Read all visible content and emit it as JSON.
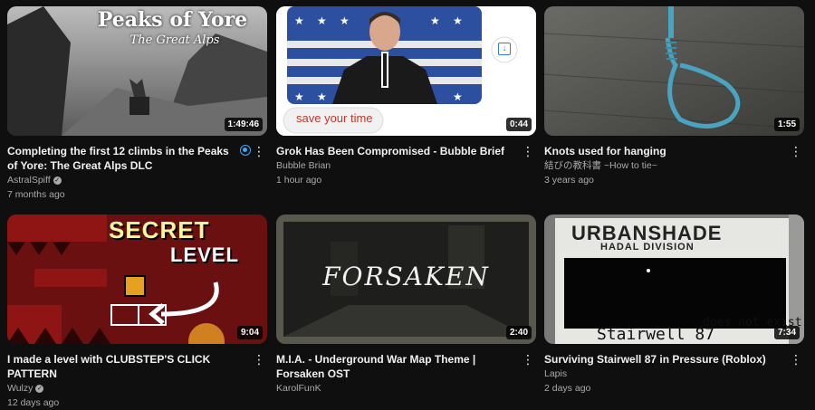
{
  "videos": [
    {
      "title": "Completing the first 12 climbs in the Peaks of Yore: The Great Alps DLC",
      "channel": "AstralSpiff",
      "verified": true,
      "age": "7 months ago",
      "duration": "1:49:46",
      "thumb_text": [
        "Peaks of Yore",
        "The Great Alps"
      ]
    },
    {
      "title": "Grok Has Been Compromised - Bubble Brief",
      "channel": "Bubble Brian",
      "verified": false,
      "age": "1 hour ago",
      "duration": "0:44",
      "thumb_text": [
        "save your time"
      ]
    },
    {
      "title": "Knots used for hanging",
      "channel": "結びの教科書 ~How to tie~",
      "verified": false,
      "age": "3 years ago",
      "duration": "1:55",
      "thumb_text": []
    },
    {
      "title": "I made a level with CLUBSTEP'S CLICK PATTERN",
      "channel": "Wulzy",
      "verified": true,
      "age": "12 days ago",
      "duration": "9:04",
      "thumb_text": [
        "SECRET",
        "LEVEL"
      ]
    },
    {
      "title": "M.I.A. - Underground War Map Theme | Forsaken OST",
      "channel": "KarolFunK",
      "verified": false,
      "age": "",
      "duration": "2:40",
      "thumb_text": [
        "FORSAKEN"
      ]
    },
    {
      "title": "Surviving Stairwell 87 in Pressure (Roblox)",
      "channel": "Lapis",
      "verified": false,
      "age": "2 days ago",
      "duration": "7:34",
      "thumb_text": [
        "URBANSHADE",
        "HADAL DIVISION",
        "Stairwell 87",
        "does not exist"
      ]
    }
  ],
  "icons": {
    "more": "more-vert-icon",
    "watched": "watched-indicator-icon",
    "verified": "verified-check-icon",
    "save": "save-icon"
  }
}
